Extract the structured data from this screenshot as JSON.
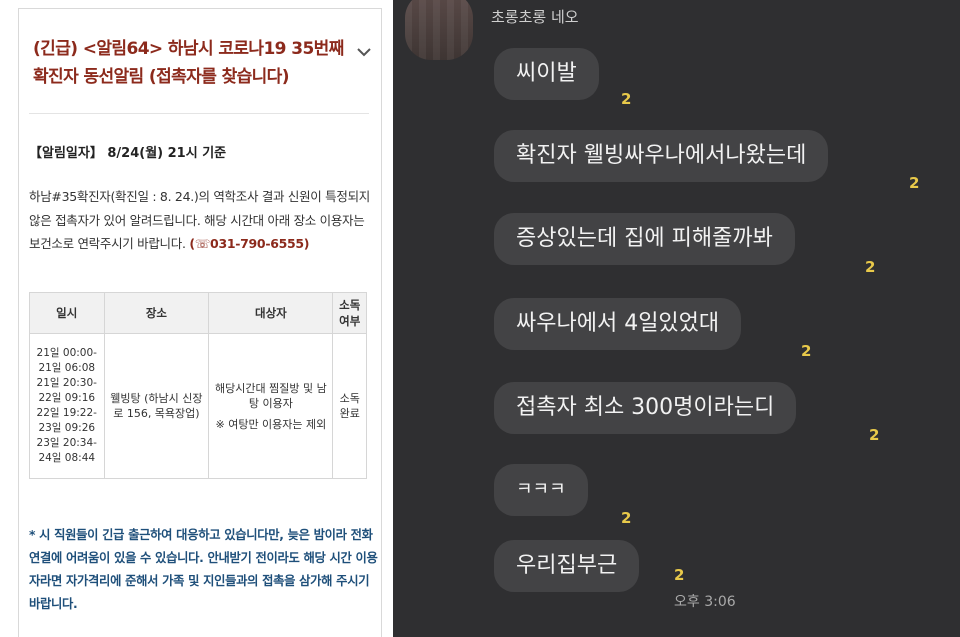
{
  "notice": {
    "title": "(긴급) <알림64> 하남시 코로나19 35번째 확진자 동선알림 (접촉자를 찾습니다)",
    "date_label": "【알림일자】 8/24(월) 21시 기준",
    "body_text": "하남#35확진자(확진일 : 8. 24.)의 역학조사 결과 신원이 특정되지 않은 접촉자가 있어 알려드립니다. 해당 시간대 아래 장소 이용자는 보건소로 연락주시기 바랍니다.",
    "phone": "(☏031-790-6555)",
    "table": {
      "headers": [
        "일시",
        "장소",
        "대상자",
        "소독 여부"
      ],
      "times": [
        "21일 00:00-21일 06:08",
        "21일 20:30-22일 09:16",
        "22일 19:22-23일 09:26",
        "23일 20:34-24일 08:44"
      ],
      "place": "웰빙탕 (하남시 신장로 156, 목욕장업)",
      "target": "해당시간대 찜질방 및 남탕 이용자",
      "target_note": "※ 여탕만 이용자는 제외",
      "disinfection": "소독완료"
    },
    "footnote": "* 시 직원들이 긴급 출근하여 대응하고 있습니다만, 늦은 밤이라 전화연결에 어려움이 있을 수 있습니다. 안내받기 전이라도 해당 시간 이용자라면 자가격리에 준해서 가족 및 지인들과의 접촉을 삼가해 주시기 바랍니다."
  },
  "chat": {
    "sender": "초롱초롱 네오",
    "messages": [
      {
        "text": "씨이발",
        "unread": "2"
      },
      {
        "text": "확진자 웰빙싸우나에서나왔는데",
        "unread": "2"
      },
      {
        "text": "증상있는데 집에 피해줄까봐",
        "unread": "2"
      },
      {
        "text": "싸우나에서 4일있었대",
        "unread": "2"
      },
      {
        "text": "접촉자 최소 300명이라는디",
        "unread": "2"
      },
      {
        "text": "ㅋㅋㅋ",
        "unread": "2"
      },
      {
        "text": "우리집부근",
        "unread": "2"
      }
    ],
    "time": "오후 3:06"
  },
  "colors": {
    "notice_title": "#8c2a1c",
    "footnote": "#1e4f7a",
    "chat_bg": "#2f2f31",
    "bubble": "#434345",
    "unread": "#e8c94a"
  }
}
